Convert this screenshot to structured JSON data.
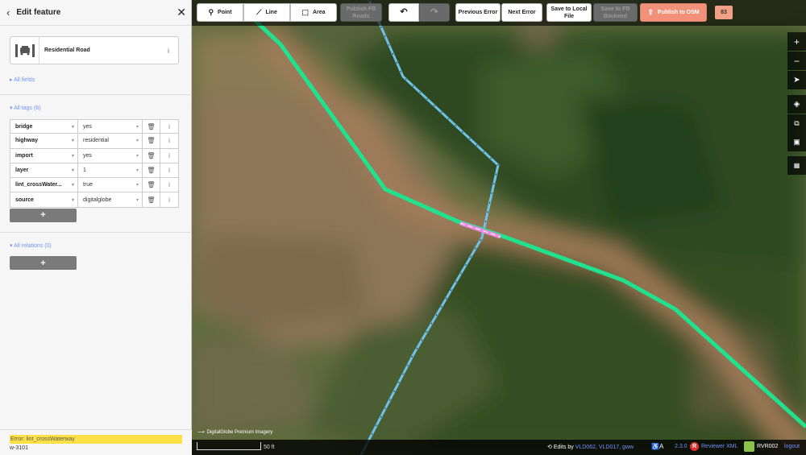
{
  "sidebar": {
    "title": "Edit feature",
    "preset_name": "Residential Road",
    "all_fields": "All fields",
    "all_tags": "All tags (6)",
    "tags": [
      {
        "key": "bridge",
        "value": "yes"
      },
      {
        "key": "highway",
        "value": "residential"
      },
      {
        "key": "import",
        "value": "yes"
      },
      {
        "key": "layer",
        "value": "1"
      },
      {
        "key": "lint_crossWater...",
        "value": "true"
      },
      {
        "key": "source",
        "value": "digitalglobe"
      }
    ],
    "add_label": "+",
    "all_relations": "All relations (0)",
    "error_text": "Error: lint_crossWaterway",
    "entity_id": "w-3101"
  },
  "toolbar": {
    "point": "Point",
    "line": "Line",
    "area": "Area",
    "publish_fb_roads": "Publish FB Roads",
    "prev_error": "Previous Error",
    "next_error": "Next Error",
    "save_local": "Save to Local File",
    "save_fb": "Save to FB Backend",
    "publish_osm": "Publish to OSM",
    "count": "83"
  },
  "map": {
    "imagery": "DigitalGlobe Premium Imagery",
    "scale": "50 ft",
    "edits_prefix": "Edits by",
    "edits_users": "VLD062, VLD017, gww",
    "version": "2.3.0",
    "reviewer": "Reviewer XML",
    "username": "RVR002",
    "logout": "logout"
  },
  "colors": {
    "road": "#20e28e",
    "waterway": "#6fc2e5",
    "bridge": "#e98ae0",
    "error_highlight": "#ffe146",
    "link": "#7092ff",
    "publish": "#f2917a"
  }
}
